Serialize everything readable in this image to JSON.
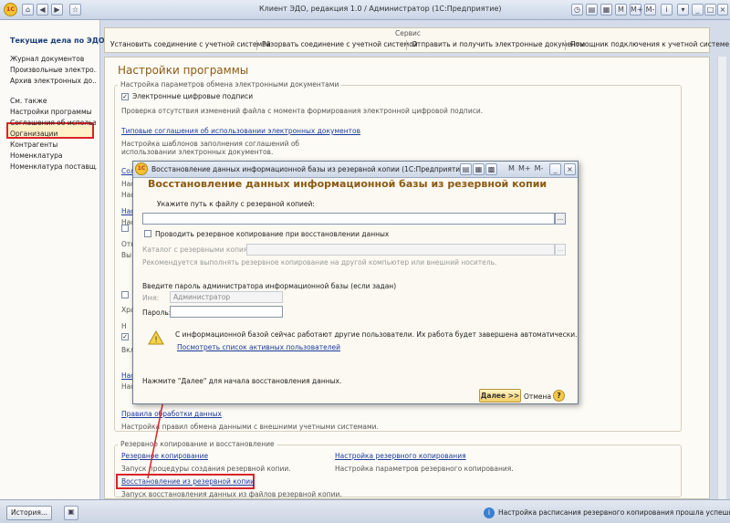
{
  "window": {
    "title": "Клиент ЭДО, редакция 1.0 / Администратор  (1С:Предприятие)",
    "logo_text": "1С"
  },
  "sidebar": {
    "header": "Текущие дела по ЭДО",
    "items": [
      "Журнал документов",
      "Произвольные электро...",
      "Архив электронных до...",
      "См. также",
      "Настройки программы",
      "Соглашения об использ...",
      "Организации",
      "Контрагенты",
      "Номенклатура",
      "Номенклатура поставщ..."
    ]
  },
  "service": {
    "title": "Сервис",
    "links": [
      "Установить соединение с учетной системой",
      "Разорвать соединение с учетной системой",
      "Отправить и получить электронные документы",
      "Помощник подключения к учетной системе"
    ]
  },
  "settings": {
    "title": "Настройки программы",
    "group1_label": "Настройка параметров обмена электронными документами",
    "digital_signatures_label": "Электронные цифровые подписи",
    "digital_signatures_desc": "Проверка отсутствия изменений файла с момента формирования электронной цифровой подписи.",
    "typical_agreements_link": "Типовые соглашения об использовании электронных документов",
    "typical_agreements_desc": "Настройка шаблонов заполнения соглашений об использовании электронных документов.",
    "partial": {
      "a": "Сол",
      "b": "Нас",
      "c": "Нас",
      "d": "Нас",
      "e": "Нас",
      "f": "Отк",
      "g": "Вы",
      "h": "Хра",
      "i": "Н",
      "j": "Вкл",
      "k": "Нас",
      "l": "Нас"
    },
    "exchange_rules_link": "Правила обработки данных",
    "exchange_rules_desc": "Настройка правил обмена данными с внешними учетными системами.",
    "backup_group_label": "Резервное копирование и восстановление",
    "backup_link": "Резервное копирование",
    "backup_desc": "Запуск процедуры создания резервной копии.",
    "backup_settings_link": "Настройка резервного копирования",
    "backup_settings_desc": "Настройка параметров резервного копирования.",
    "restore_link": "Восстановление из резервной копии",
    "restore_desc": "Запуск восстановления данных из файлов резервной копии."
  },
  "dialog": {
    "window_title": "Восстановление данных информационной базы из резервной копии  (1С:Предприятие)",
    "heading": "Восстановление данных информационной базы из резервной копии",
    "path_label": "Укажите путь к файлу с резервной копией:",
    "path_value": "",
    "backup_on_restore_label": "Проводить резервное копирование при восстановлении данных",
    "backup_dir_label": "Каталог с резервными копиями:",
    "backup_dir_hint": "Рекомендуется выполнять резервное копирование на другой компьютер или внешний носитель.",
    "admin_password_label": "Введите пароль администратора информационной базы (если задан)",
    "name_label": "Имя:",
    "name_value": "Администратор",
    "password_label": "Пароль:",
    "password_value": "",
    "users_warning": "С информационной базой сейчас работают другие пользователи. Их работа будет завершена автоматически.",
    "active_users_link": "Посмотреть список активных пользователей",
    "next_hint": "Нажмите \"Далее\" для начала восстановления данных.",
    "next_button": "Далее >>",
    "cancel_button": "Отмена",
    "help": "?",
    "ellipsis": "...",
    "toolbar_icons": [
      "M",
      "M+",
      "M-"
    ]
  },
  "statusbar": {
    "history_button": "История...",
    "message": "Настройка расписания резервного копирования прошла успешно."
  },
  "icons": [
    "home-icon",
    "back-icon",
    "forward-icon",
    "star-icon",
    "warning-icon",
    "info-icon",
    "help-icon",
    "close-icon"
  ]
}
